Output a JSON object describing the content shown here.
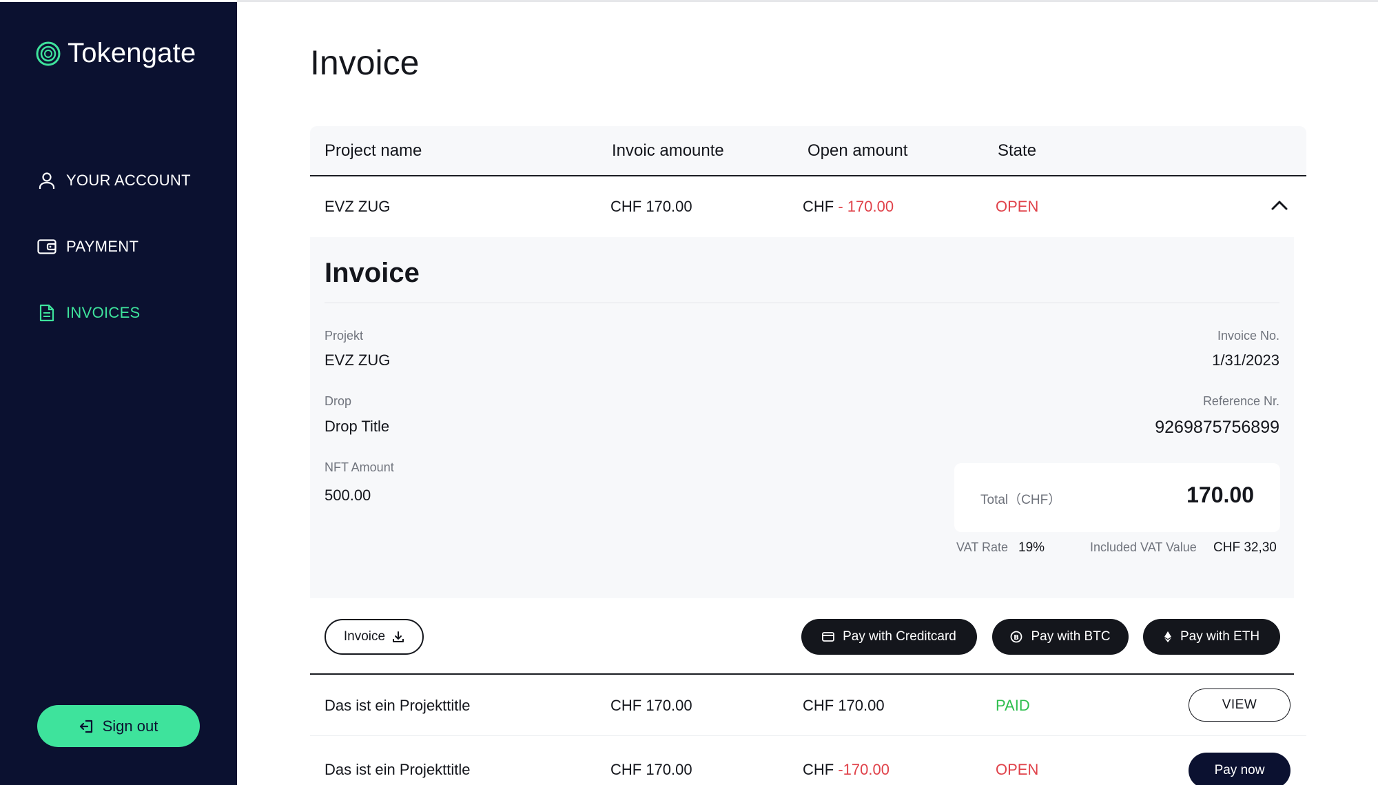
{
  "sidebar": {
    "brand": "Tokengate",
    "nav": [
      {
        "label": "YOUR ACCOUNT",
        "icon": "user-icon"
      },
      {
        "label": "PAYMENT",
        "icon": "wallet-icon"
      },
      {
        "label": "INVOICES",
        "icon": "document-icon",
        "active": true
      }
    ],
    "signout_label": "Sign out"
  },
  "main": {
    "title": "Invoice",
    "table": {
      "headers": [
        "Project name",
        "Invoic amounte",
        "Open amount",
        "State"
      ],
      "rows": [
        {
          "project": "EVZ ZUG",
          "invoice_amount": "CHF 170.00",
          "open_currency": "CHF",
          "open_value": "- 170.00",
          "state": "OPEN",
          "expanded": true
        },
        {
          "project": "Das ist ein Projekttitle",
          "invoice_amount": "CHF 170.00",
          "open_amount": "CHF 170.00",
          "state": "PAID",
          "action": "VIEW"
        },
        {
          "project": "Das ist ein Projekttitle",
          "invoice_amount": "CHF 170.00",
          "open_currency": "CHF",
          "open_value": "-170.00",
          "state": "OPEN",
          "action": "Pay now"
        }
      ]
    },
    "detail": {
      "title": "Invoice",
      "projekt_label": "Projekt",
      "projekt_value": "EVZ ZUG",
      "drop_label": "Drop",
      "drop_value": "Drop Title",
      "nft_label": "NFT Amount",
      "nft_value": "500.00",
      "invoice_no_label": "Invoice No.",
      "invoice_no_value": "1/31/2023",
      "reference_label": "Reference Nr.",
      "reference_value": "9269875756899",
      "total_label": "Total（CHF）",
      "total_value": "170.00",
      "vat_rate_label": "VAT Rate",
      "vat_rate_value": "19%",
      "vat_value_label": "Included VAT Value",
      "vat_value_value": "CHF 32,30"
    },
    "actions": {
      "invoice_download": "Invoice",
      "pay_card": "Pay with Creditcard",
      "pay_btc": "Pay with BTC",
      "pay_eth": "Pay with ETH"
    }
  },
  "colors": {
    "sidebar_bg": "#0b1130",
    "accent_green": "#3ee39c",
    "negative_red": "#e0424a",
    "paid_green": "#2fbf4f"
  }
}
